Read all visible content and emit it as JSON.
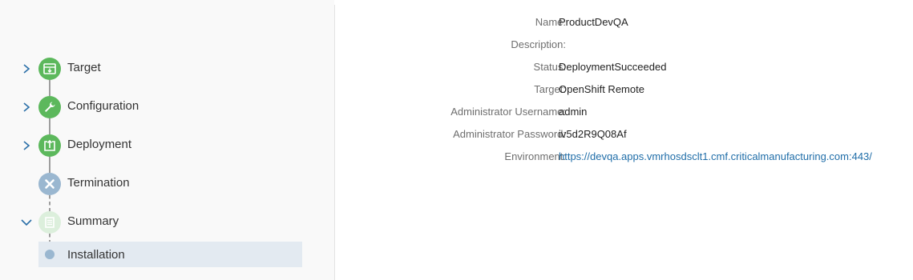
{
  "wizard": {
    "steps": [
      {
        "label": "Target",
        "icon": "box-download-icon",
        "state": "complete"
      },
      {
        "label": "Configuration",
        "icon": "wrench-icon",
        "state": "complete"
      },
      {
        "label": "Deployment",
        "icon": "upload-box-icon",
        "state": "complete"
      },
      {
        "label": "Termination",
        "icon": "close-icon",
        "state": "skipped"
      },
      {
        "label": "Summary",
        "icon": "document-icon",
        "state": "active"
      }
    ],
    "substep": {
      "label": "Installation"
    }
  },
  "details": {
    "rows": [
      {
        "key": "Name:",
        "value": "ProductDevQA"
      },
      {
        "key": "Description:",
        "value": ""
      },
      {
        "key": "Status:",
        "value": "DeploymentSucceeded"
      },
      {
        "key": "Target:",
        "value": "OpenShift Remote"
      },
      {
        "key": "Administrator Username:",
        "value": "admin"
      },
      {
        "key": "Administrator Password:",
        "value": "iv5d2R9Q08Af"
      },
      {
        "key": "Environment:",
        "value": "https://devqa.apps.vmrhosdsclt1.cmf.criticalmanufacturing.com:443/"
      }
    ]
  },
  "colors": {
    "complete": "#5cb85c",
    "skipped": "#9ab7d0",
    "active_faded": "#dcefdc",
    "link": "#1f6da8",
    "selected_row": "#e3eaf1"
  }
}
